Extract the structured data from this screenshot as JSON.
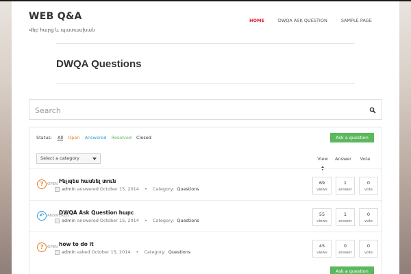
{
  "site": {
    "title": "WEB Q&A",
    "tagline": "Վեբ հարց և պատասխան"
  },
  "nav": {
    "items": [
      {
        "label": "HOME",
        "active": true
      },
      {
        "label": "DWQA ASK QUESTION",
        "active": false
      },
      {
        "label": "SAMPLE PAGE",
        "active": false
      }
    ]
  },
  "page": {
    "title": "DWQA Questions"
  },
  "search": {
    "placeholder": "Search"
  },
  "filters": {
    "label": "Status:",
    "all": "All",
    "open": "Open",
    "answered": "Answered",
    "resolved": "Resolved",
    "closed": "Closed"
  },
  "ask_button_label": "Ask a question",
  "category_select": {
    "selected": "Select a category"
  },
  "columns": {
    "view": "View",
    "answer": "Answer",
    "vote": "Vote"
  },
  "questions": [
    {
      "title": "Ինչպես հասնել տուն",
      "status": "Open",
      "author": "admin",
      "action": "answered",
      "date": "October 15, 2014",
      "category_label": "Category:",
      "category": "Questions",
      "views": "69",
      "views_label": "views",
      "answers": "1",
      "answers_label": "answer",
      "votes": "0",
      "votes_label": "vote"
    },
    {
      "title": "DWQA Ask Question hարc",
      "status": "Answered",
      "author": "admin",
      "action": "answered",
      "date": "October 15, 2014",
      "category_label": "Category:",
      "category": "Questions",
      "views": "55",
      "views_label": "views",
      "answers": "1",
      "answers_label": "answer",
      "votes": "0",
      "votes_label": "vote"
    },
    {
      "title": "how to do it",
      "status": "Open",
      "author": "admin",
      "action": "asked",
      "date": "October 15, 2014",
      "category_label": "Category:",
      "category": "Questions",
      "views": "45",
      "views_label": "views",
      "answers": "0",
      "answers_label": "answer",
      "votes": "0",
      "votes_label": "vote"
    }
  ],
  "colors": {
    "accent": "#d8232a",
    "ask_button": "#5cb85c",
    "open": "#e67e22",
    "answered": "#2a9fd6",
    "resolved": "#5cb85c"
  }
}
